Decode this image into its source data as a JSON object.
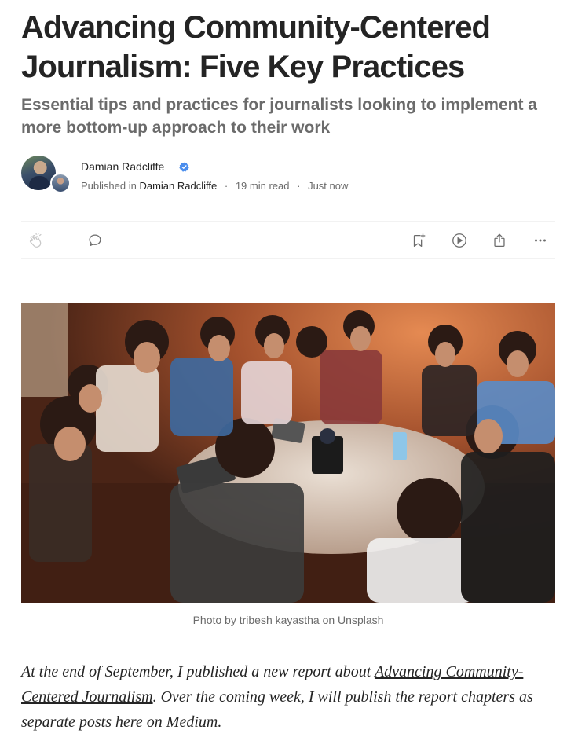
{
  "article": {
    "title": "Advancing Community-Centered Journalism: Five Key Practices",
    "subtitle": "Essential tips and practices for journalists looking to implement a more bottom-up approach to their work"
  },
  "author": {
    "name": "Damian Radcliffe",
    "published_in_label": "Published in",
    "publication": "Damian Radcliffe",
    "read_time": "19 min read",
    "posted": "Just now",
    "separator": "·"
  },
  "actions": {
    "icons": [
      "clap-icon",
      "comment-icon",
      "bookmark-add-icon",
      "listen-play-icon",
      "share-icon",
      "more-icon"
    ]
  },
  "caption": {
    "prefix": "Photo by",
    "photographer": "tribesh kayastha",
    "middle": "on",
    "source": "Unsplash"
  },
  "body": {
    "text_before_link": "At the end of September, I published a new report about ",
    "link_text": "Advancing Community-Centered Journalism",
    "text_after_link": ". Over the coming week, I will publish the report chapters as separate posts here on Medium."
  },
  "colors": {
    "text_primary": "#242424",
    "text_secondary": "#6b6b6b",
    "verified_badge": "#4a8ded",
    "divider": "#f2f2f2"
  }
}
